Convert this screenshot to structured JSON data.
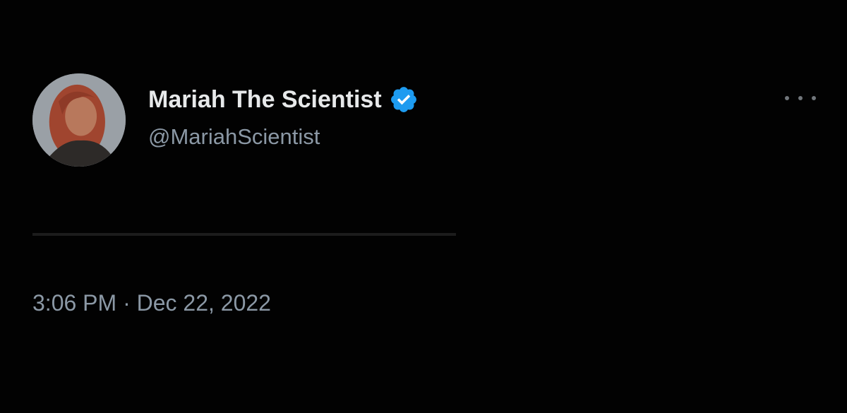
{
  "tweet": {
    "display_name": "Mariah The Scientist",
    "handle": "@MariahScientist",
    "time": "3:06 PM",
    "separator": " · ",
    "date": "Dec 22, 2022",
    "verified": true,
    "icons": {
      "verified": "verified-badge-icon",
      "more": "more-options-icon",
      "avatar": "profile-photo"
    },
    "colors": {
      "background": "#020202",
      "primary_text": "#e7e9ea",
      "secondary_text": "#8b98a5",
      "verified_badge": "#1d9bf0"
    }
  }
}
